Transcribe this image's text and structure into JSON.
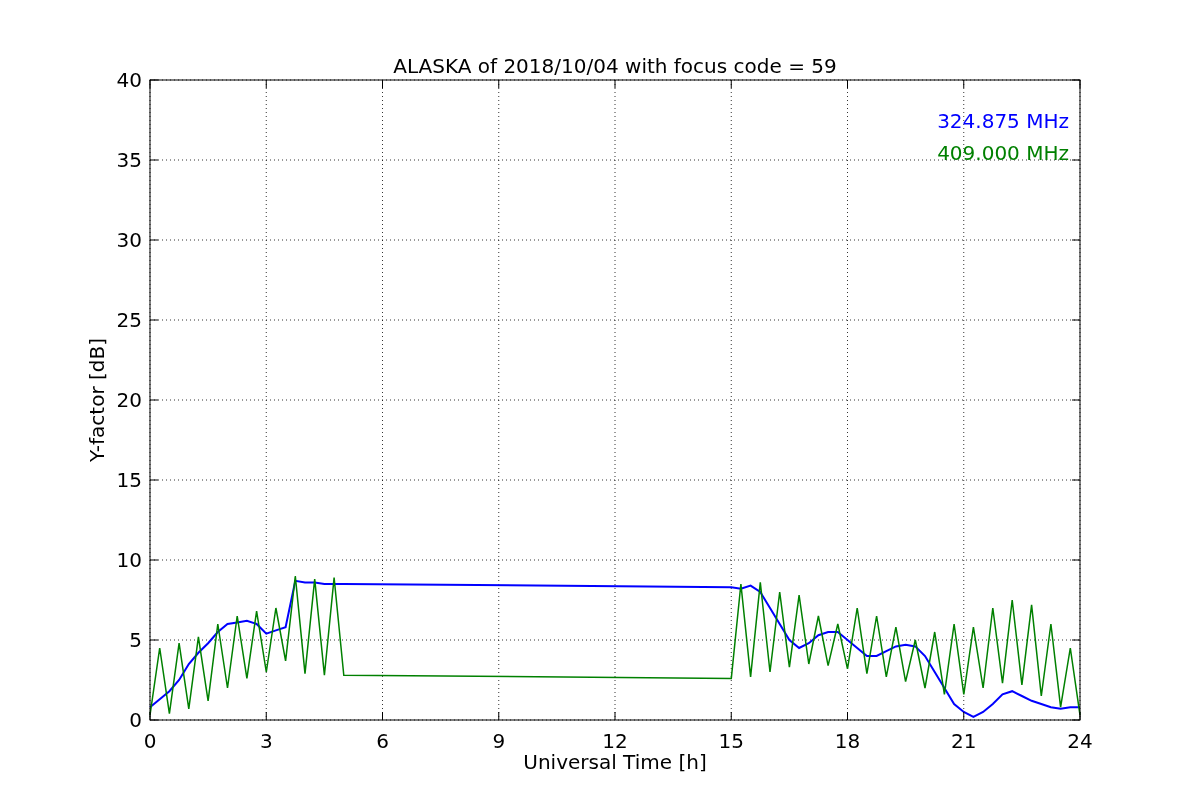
{
  "figure": {
    "chart_data": {
      "type": "line",
      "title": "ALASKA of 2018/10/04 with focus code = 59",
      "xlabel": "Universal Time [h]",
      "ylabel": "Y-factor [dB]",
      "x": [
        0,
        0.25,
        0.5,
        0.75,
        1,
        1.25,
        1.5,
        1.75,
        2,
        2.25,
        2.5,
        2.75,
        3,
        3.25,
        3.5,
        3.75,
        4,
        4.25,
        4.5,
        4.75,
        5,
        15,
        15.25,
        15.5,
        15.75,
        16,
        16.25,
        16.5,
        16.75,
        17,
        17.25,
        17.5,
        17.75,
        18,
        18.25,
        18.5,
        18.75,
        19,
        19.25,
        19.5,
        19.75,
        20,
        20.25,
        20.5,
        20.75,
        21,
        21.25,
        21.5,
        21.75,
        22,
        22.25,
        22.5,
        22.75,
        23,
        23.25,
        23.5,
        23.75,
        24
      ],
      "series": [
        {
          "name": "324.875 MHz",
          "color": "#0000ff",
          "values": [
            0.8,
            1.3,
            1.8,
            2.5,
            3.5,
            4.2,
            4.8,
            5.5,
            6.0,
            6.1,
            6.2,
            6.0,
            5.4,
            5.6,
            5.8,
            8.7,
            8.6,
            8.6,
            8.5,
            8.5,
            8.5,
            8.3,
            8.2,
            8.4,
            8.0,
            7.0,
            6.0,
            5.0,
            4.5,
            4.8,
            5.3,
            5.5,
            5.5,
            5.0,
            4.5,
            4.0,
            4.0,
            4.3,
            4.6,
            4.7,
            4.6,
            4.0,
            3.0,
            2.0,
            1.0,
            0.5,
            0.2,
            0.5,
            1.0,
            1.6,
            1.8,
            1.5,
            1.2,
            1.0,
            0.8,
            0.7,
            0.8,
            0.8
          ]
        },
        {
          "name": "409.000 MHz",
          "color": "#008000",
          "values": [
            0.3,
            4.5,
            0.4,
            4.8,
            0.7,
            5.2,
            1.2,
            6.0,
            2.0,
            6.5,
            2.6,
            6.8,
            3.0,
            7.0,
            3.7,
            9.0,
            2.9,
            8.8,
            2.8,
            8.9,
            2.8,
            2.6,
            8.5,
            2.7,
            8.6,
            3.0,
            8.0,
            3.3,
            7.8,
            3.5,
            6.5,
            3.4,
            6.0,
            3.2,
            7.0,
            2.9,
            6.5,
            2.7,
            5.8,
            2.4,
            5.0,
            2.0,
            5.5,
            1.6,
            6.0,
            1.6,
            5.8,
            2.0,
            7.0,
            2.3,
            7.5,
            2.2,
            7.2,
            1.5,
            6.0,
            0.8,
            4.5,
            0.3
          ]
        }
      ],
      "xlim": [
        0,
        24
      ],
      "ylim": [
        0,
        40
      ],
      "xticks": [
        0,
        3,
        6,
        9,
        12,
        15,
        18,
        21,
        24
      ],
      "yticks": [
        0,
        5,
        10,
        15,
        20,
        25,
        30,
        35,
        40
      ],
      "grid": true
    }
  }
}
